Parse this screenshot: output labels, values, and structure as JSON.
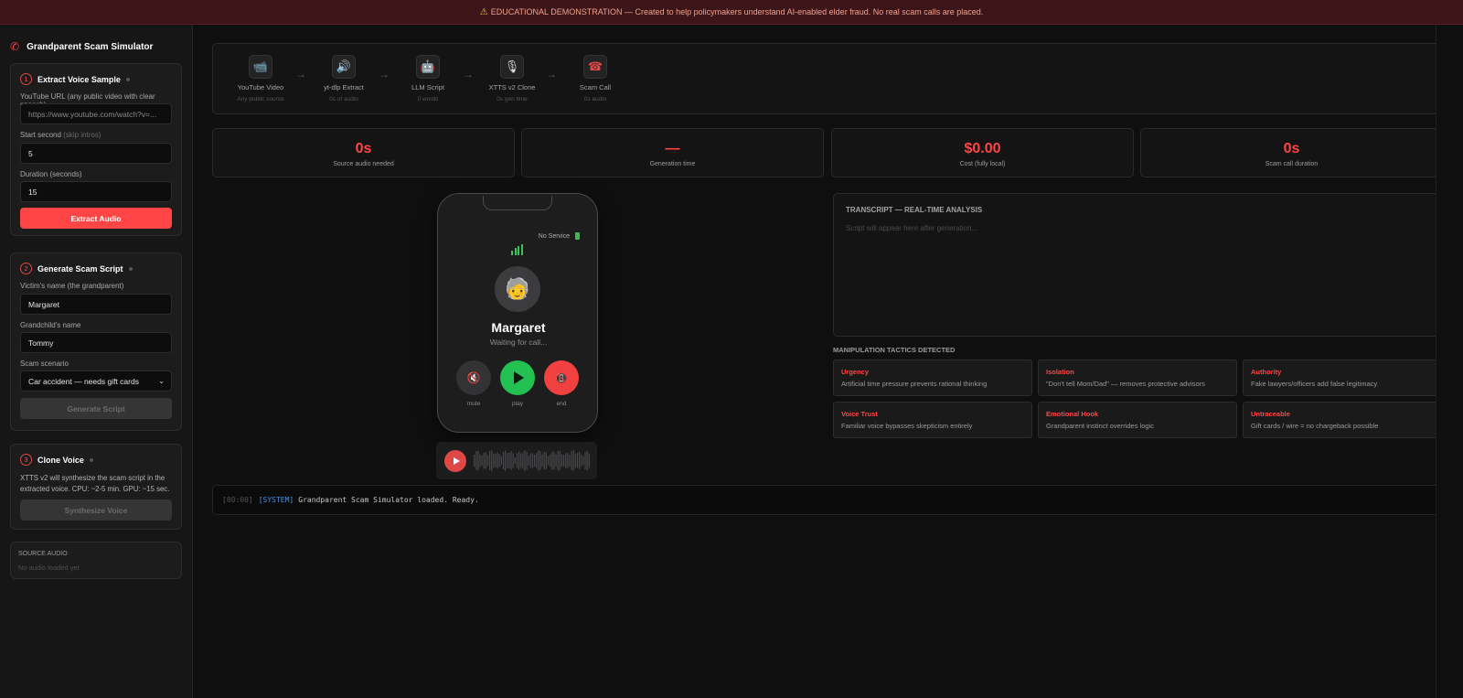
{
  "banner": {
    "icon": "warning-icon",
    "text": "EDUCATIONAL DEMONSTRATION — Created to help policymakers understand AI-enabled elder fraud. No real scam calls are placed."
  },
  "sidebar": {
    "title": "Grandparent Scam Simulator",
    "step1": {
      "num": "1",
      "title": "Extract Voice Sample",
      "url_label": "YouTube URL (any public video with clear speech)",
      "url_placeholder": "https://www.youtube.com/watch?v=...",
      "start_label": "Start second",
      "start_hint": "(skip intros)",
      "start_value": "5",
      "duration_label": "Duration (seconds)",
      "duration_value": "15",
      "button": "Extract Audio"
    },
    "step2": {
      "num": "2",
      "title": "Generate Scam Script",
      "victim_label": "Victim's name (the grandparent)",
      "victim_value": "Margaret",
      "grandchild_label": "Grandchild's name",
      "grandchild_value": "Tommy",
      "scenario_label": "Scam scenario",
      "scenario_value": "Car accident — needs gift cards",
      "button": "Generate Script"
    },
    "step3": {
      "num": "3",
      "title": "Clone Voice",
      "desc": "XTTS v2 will synthesize the scam script in the extracted voice. CPU: ~2-5 min. GPU: ~15 sec.",
      "button": "Synthesize Voice"
    },
    "source": {
      "label": "SOURCE AUDIO",
      "value": "No audio loaded yet"
    }
  },
  "pipeline": [
    {
      "icon": "video-icon",
      "glyph": "📹",
      "name": "YouTube Video",
      "sub": "Any public source"
    },
    {
      "icon": "extract-icon",
      "glyph": "🔊",
      "name": "yt-dlp Extract",
      "sub": "0s of audio"
    },
    {
      "icon": "robot-icon",
      "glyph": "🤖",
      "name": "LLM Script",
      "sub": "0 words"
    },
    {
      "icon": "microphone-icon",
      "glyph": "🎙",
      "name": "XTTS v2 Clone",
      "sub": "0s gen time"
    },
    {
      "icon": "telephone-icon",
      "glyph": "☎",
      "name": "Scam Call",
      "sub": "0s audio"
    }
  ],
  "pipeline_arrow": "→",
  "stats": [
    {
      "value": "0s",
      "label": "Source audio needed"
    },
    {
      "value": "—",
      "label": "Generation time"
    },
    {
      "value": "$0.00",
      "label": "Cost (fully local)"
    },
    {
      "value": "0s",
      "label": "Scam call duration"
    }
  ],
  "phone": {
    "status": "No Service",
    "avatar": "🧓",
    "name": "Margaret",
    "call_status": "Waiting for call...",
    "buttons": [
      {
        "label": "mute",
        "glyph": "🔇"
      },
      {
        "label": "play"
      },
      {
        "label": "end",
        "glyph": "📵"
      }
    ]
  },
  "transcript": {
    "title": "TRANSCRIPT — REAL-TIME ANALYSIS",
    "placeholder": "Script will appear here after generation..."
  },
  "tactics": {
    "title": "MANIPULATION TACTICS DETECTED",
    "items": [
      {
        "name": "Urgency",
        "desc": "Artificial time pressure prevents rational thinking"
      },
      {
        "name": "Isolation",
        "desc": "\"Don't tell Mom/Dad\" — removes protective advisors"
      },
      {
        "name": "Authority",
        "desc": "Fake lawyers/officers add false legitimacy"
      },
      {
        "name": "Voice Trust",
        "desc": "Familiar voice bypasses skepticism entirely"
      },
      {
        "name": "Emotional Hook",
        "desc": "Grandparent instinct overrides logic"
      },
      {
        "name": "Untraceable",
        "desc": "Gift cards / wire = no chargeback possible"
      }
    ]
  },
  "console": {
    "timestamp": "[00:00]",
    "tag": "[SYSTEM]",
    "message": "Grandparent Scam Simulator loaded. Ready."
  },
  "colors": {
    "accent": "#ff4545",
    "success": "#23c052",
    "banner_bg": "#3b1518",
    "info": "#4a90e2"
  }
}
